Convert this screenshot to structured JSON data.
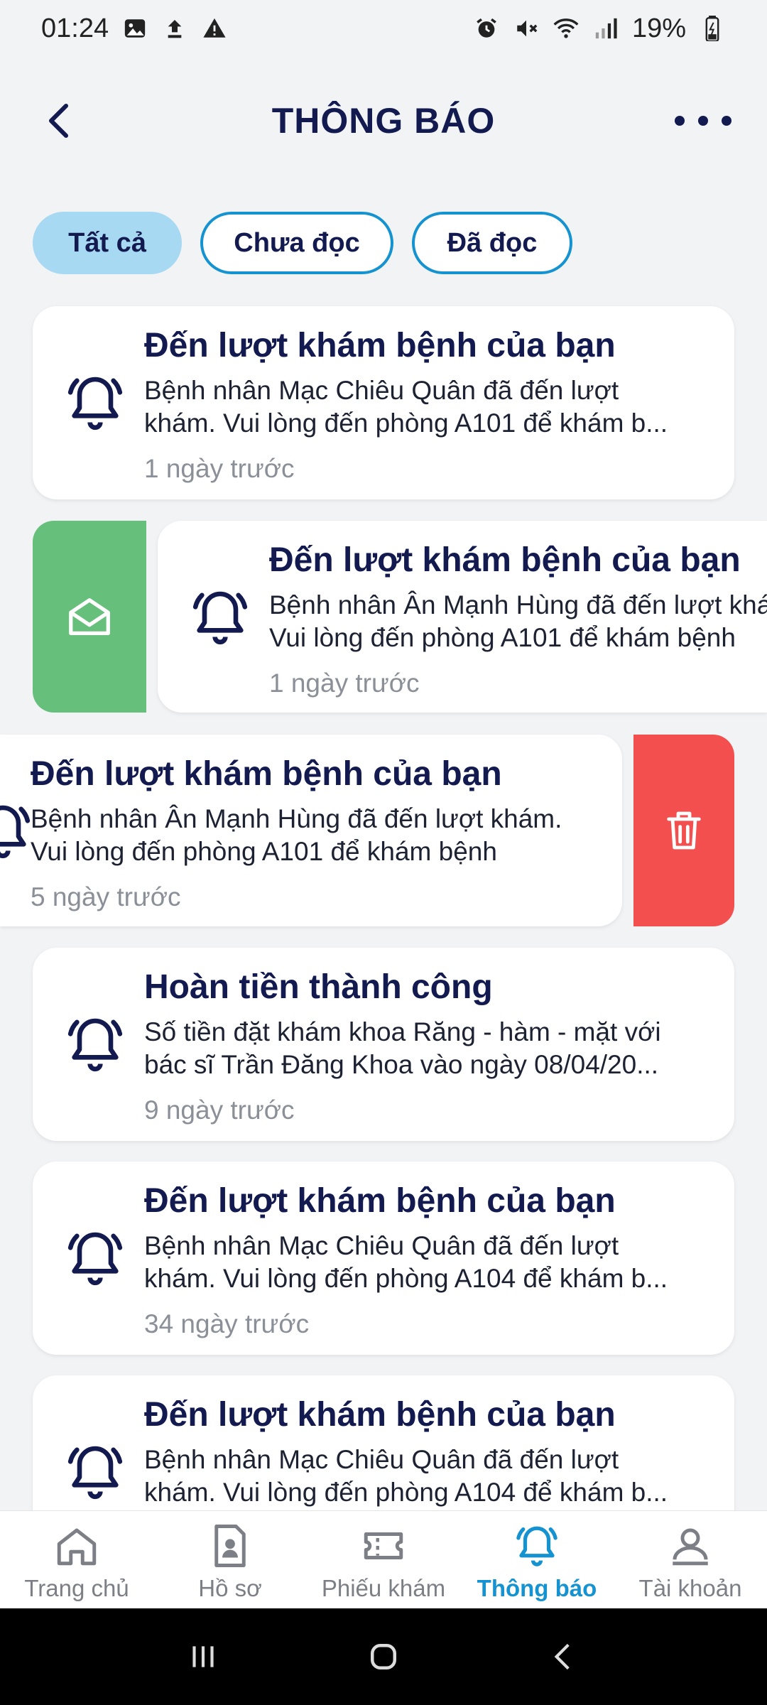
{
  "status_bar": {
    "time": "01:24",
    "battery": "19%"
  },
  "header": {
    "title": "THÔNG BÁO"
  },
  "tabs": [
    {
      "label": "Tất cả",
      "active": true
    },
    {
      "label": "Chưa đọc",
      "active": false
    },
    {
      "label": "Đã đọc",
      "active": false
    }
  ],
  "notifications": [
    {
      "title": "Đến lượt khám bệnh của bạn",
      "body_line1": "Bệnh nhân Mạc Chiêu Quân đã đến lượt",
      "body_line2": "khám. Vui lòng đến phòng A101 để khám b...",
      "time": "1 ngày trước"
    },
    {
      "title": "Đến lượt khám bệnh của bạn",
      "body_line1": "Bệnh nhân Ân Mạnh Hùng đã đến lượt khám.",
      "body_line2": "Vui lòng đến phòng A101 để khám bệnh",
      "time": "1 ngày trước"
    },
    {
      "title": "Đến lượt khám bệnh của bạn",
      "body_line1": "Bệnh nhân Ân Mạnh Hùng đã đến lượt khám.",
      "body_line2": "Vui lòng đến phòng A101 để khám bệnh",
      "time": "5 ngày trước"
    },
    {
      "title": "Hoàn tiền thành công",
      "body_line1": "Số tiền đặt khám khoa Răng - hàm - mặt với",
      "body_line2": "bác sĩ Trần Đăng Khoa vào ngày 08/04/20...",
      "time": "9 ngày trước"
    },
    {
      "title": "Đến lượt khám bệnh của bạn",
      "body_line1": "Bệnh nhân Mạc Chiêu Quân đã đến lượt",
      "body_line2": "khám. Vui lòng đến phòng A104 để khám b...",
      "time": "34 ngày trước"
    },
    {
      "title": "Đến lượt khám bệnh của bạn",
      "body_line1": "Bệnh nhân Mạc Chiêu Quân đã đến lượt",
      "body_line2": "khám. Vui lòng đến phòng A104 để khám b..."
    }
  ],
  "bottom_nav": [
    {
      "label": "Trang chủ",
      "icon": "home-icon"
    },
    {
      "label": "Hồ sơ",
      "icon": "profile-document-icon"
    },
    {
      "label": "Phiếu khám",
      "icon": "ticket-icon"
    },
    {
      "label": "Thông báo",
      "icon": "bell-icon",
      "active": true
    },
    {
      "label": "Tài khoản",
      "icon": "account-icon"
    }
  ],
  "colors": {
    "accent": "#1593d1",
    "title": "#121a4f",
    "mark_read": "#66bf7b",
    "delete": "#f44f4f"
  }
}
